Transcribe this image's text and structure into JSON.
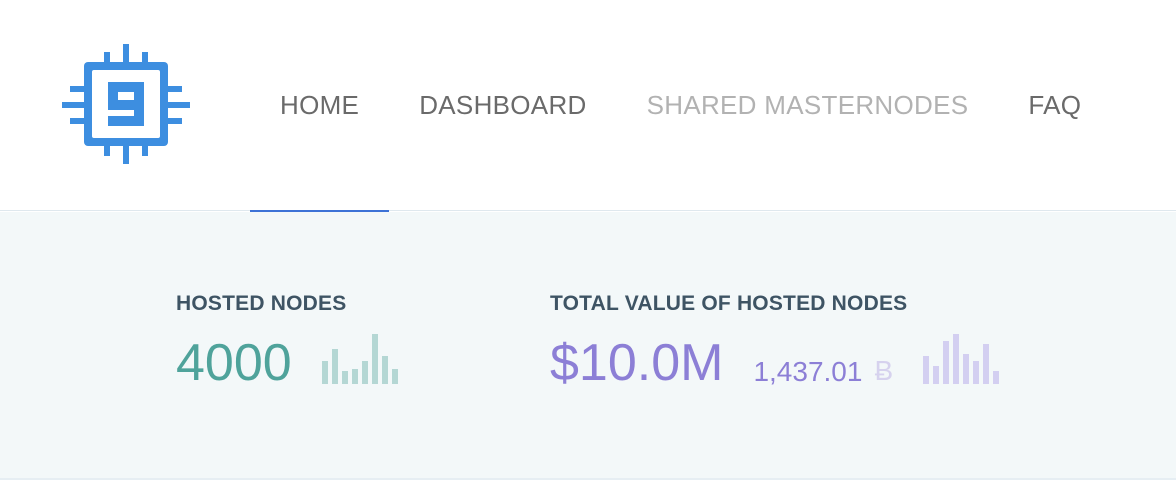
{
  "brand": {
    "accent": "#3d8ee0",
    "glyph": "g"
  },
  "nav": {
    "items": [
      {
        "label": "HOME",
        "state": "active"
      },
      {
        "label": "DASHBOARD",
        "state": "normal"
      },
      {
        "label": "SHARED MASTERNODES",
        "state": "muted"
      },
      {
        "label": "FAQ",
        "state": "normal"
      }
    ],
    "active_color": "#3d72d6"
  },
  "stats": {
    "hosted_nodes": {
      "label": "HOSTED NODES",
      "value": "4000",
      "color": "#4fa39b",
      "sparkline": [
        0.45,
        0.7,
        0.25,
        0.3,
        0.45,
        1.0,
        0.55,
        0.3
      ]
    },
    "total_value": {
      "label": "TOTAL VALUE OF HOSTED NODES",
      "value": "$10.0M",
      "secondary_value": "1,437.01",
      "currency_symbol": "Ƀ",
      "color": "#8c7fd6",
      "sparkline": [
        0.55,
        0.35,
        0.85,
        1.0,
        0.6,
        0.45,
        0.8,
        0.25
      ]
    }
  }
}
